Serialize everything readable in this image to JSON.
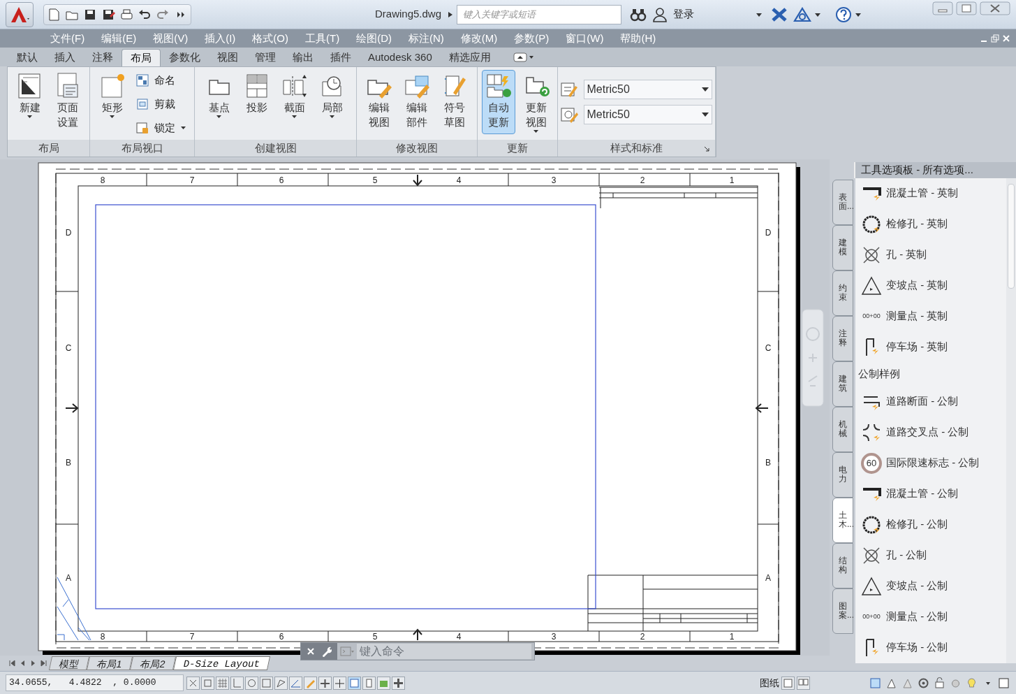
{
  "title_bar": {
    "title": "Drawing5.dwg",
    "search_placeholder": "键入关键字或短语",
    "user": "登录"
  },
  "menu": [
    "文件(F)",
    "编辑(E)",
    "视图(V)",
    "插入(I)",
    "格式(O)",
    "工具(T)",
    "绘图(D)",
    "标注(N)",
    "修改(M)",
    "参数(P)",
    "窗口(W)",
    "帮助(H)"
  ],
  "ribbon_tabs": [
    {
      "label": "默认",
      "selected": false
    },
    {
      "label": "插入",
      "selected": false
    },
    {
      "label": "注释",
      "selected": false
    },
    {
      "label": "布局",
      "selected": true
    },
    {
      "label": "参数化",
      "selected": false
    },
    {
      "label": "视图",
      "selected": false
    },
    {
      "label": "管理",
      "selected": false
    },
    {
      "label": "输出",
      "selected": false
    },
    {
      "label": "插件",
      "selected": false
    },
    {
      "label": "Autodesk 360",
      "selected": false
    },
    {
      "label": "精选应用",
      "selected": false
    }
  ],
  "ribbon_panels": [
    {
      "title": "布局",
      "tools": [
        {
          "kind": "large",
          "lines": [
            "新建"
          ],
          "dropdown": true,
          "selected": false
        },
        {
          "kind": "large",
          "lines": [
            "页面",
            "设置"
          ],
          "dropdown": false,
          "selected": false
        }
      ]
    },
    {
      "title": "布局视口",
      "tools": [
        {
          "kind": "large",
          "lines": [
            "矩形"
          ],
          "dropdown": true,
          "selected": false
        },
        {
          "kind": "small",
          "lines": [
            "命名"
          ],
          "dropdown": false,
          "selected": false
        },
        {
          "kind": "small",
          "lines": [
            "剪裁"
          ],
          "dropdown": false,
          "selected": false
        },
        {
          "kind": "small",
          "lines": [
            "锁定"
          ],
          "dropdown": true,
          "selected": false
        }
      ]
    },
    {
      "title": "创建视图",
      "tools": [
        {
          "kind": "large",
          "lines": [
            "基点"
          ],
          "dropdown": true,
          "selected": false
        },
        {
          "kind": "large",
          "lines": [
            "投影"
          ],
          "dropdown": false,
          "selected": false
        },
        {
          "kind": "large",
          "lines": [
            "截面"
          ],
          "dropdown": true,
          "selected": false
        },
        {
          "kind": "large",
          "lines": [
            "局部"
          ],
          "dropdown": true,
          "selected": false
        }
      ]
    },
    {
      "title": "修改视图",
      "tools": [
        {
          "kind": "large",
          "lines": [
            "编辑",
            "视图"
          ],
          "dropdown": false,
          "selected": false
        },
        {
          "kind": "large",
          "lines": [
            "编辑",
            "部件"
          ],
          "dropdown": false,
          "selected": false
        },
        {
          "kind": "large",
          "lines": [
            "符号",
            "草图"
          ],
          "dropdown": false,
          "selected": false
        }
      ]
    },
    {
      "title": "更新",
      "tools": [
        {
          "kind": "large",
          "lines": [
            "自动",
            "更新"
          ],
          "dropdown": false,
          "selected": true
        },
        {
          "kind": "large",
          "lines": [
            "更新",
            "视图"
          ],
          "dropdown": true,
          "selected": false
        }
      ]
    },
    {
      "title": "样式和标准",
      "tools": [
        {
          "kind": "combo",
          "lines": [
            "Metric50"
          ],
          "dropdown": true,
          "selected": false
        },
        {
          "kind": "combo",
          "lines": [
            "Metric50"
          ],
          "dropdown": true,
          "selected": false
        }
      ]
    }
  ],
  "drawing": {
    "top_numbers": [
      "8",
      "7",
      "6",
      "5",
      "4",
      "3",
      "2",
      "1"
    ],
    "bottom_numbers": [
      "8",
      "7",
      "6",
      "5",
      "4",
      "3",
      "2",
      "1"
    ],
    "left_letters": [
      "D",
      "C",
      "B",
      "A"
    ],
    "right_letters": [
      "D",
      "C",
      "B",
      "A"
    ]
  },
  "command_line": {
    "placeholder": "键入命令"
  },
  "layout_tabs": [
    {
      "label": "模型",
      "selected": false
    },
    {
      "label": "布局1",
      "selected": false
    },
    {
      "label": "布局2",
      "selected": false
    },
    {
      "label": "D-Size Layout",
      "selected": true
    }
  ],
  "status_bar": {
    "coordinates": "34.0655,   4.4822  , 0.0000",
    "space": "图纸"
  },
  "tool_palette": {
    "title": "工具选项板 - 所有选项...",
    "side_tabs": [
      {
        "label": "表面...",
        "selected": false
      },
      {
        "label": "建模",
        "selected": false
      },
      {
        "label": "约束",
        "selected": false
      },
      {
        "label": "注释",
        "selected": false
      },
      {
        "label": "建筑",
        "selected": false
      },
      {
        "label": "机械",
        "selected": false
      },
      {
        "label": "电力",
        "selected": false
      },
      {
        "label": "土木...",
        "selected": true
      },
      {
        "label": "结构",
        "selected": false
      },
      {
        "label": "图案...",
        "selected": false
      }
    ],
    "items": [
      {
        "kind": "tool",
        "label": "混凝土管 - 英制"
      },
      {
        "kind": "tool",
        "label": "检修孔 - 英制"
      },
      {
        "kind": "tool",
        "label": "孔 - 英制"
      },
      {
        "kind": "tool",
        "label": "变坡点 - 英制"
      },
      {
        "kind": "tool",
        "label": "测量点 - 英制",
        "icon_text": "00+00"
      },
      {
        "kind": "tool",
        "label": "停车场 - 英制"
      },
      {
        "kind": "header",
        "label": "公制样例"
      },
      {
        "kind": "tool",
        "label": "道路断面 - 公制"
      },
      {
        "kind": "tool",
        "label": "道路交叉点 - 公制"
      },
      {
        "kind": "tool",
        "label": "国际限速标志 - 公制",
        "icon_text": "60"
      },
      {
        "kind": "tool",
        "label": "混凝土管 - 公制"
      },
      {
        "kind": "tool",
        "label": "检修孔 - 公制"
      },
      {
        "kind": "tool",
        "label": "孔 - 公制"
      },
      {
        "kind": "tool",
        "label": "变坡点 - 公制"
      },
      {
        "kind": "tool",
        "label": "测量点 - 公制",
        "icon_text": "00+00"
      },
      {
        "kind": "tool",
        "label": "停车场 - 公制"
      }
    ]
  }
}
